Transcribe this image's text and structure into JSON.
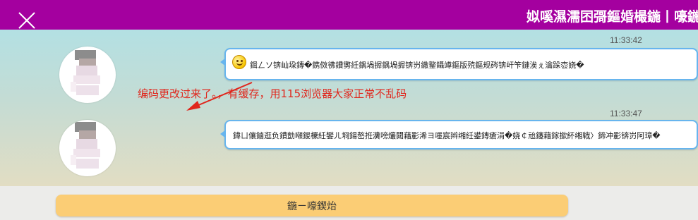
{
  "header": {
    "title": "姒嗘濕濡囨彁鏂婚樶鍦丨嚎鍦",
    "close_icon": "close-icon",
    "background": "#a4009f"
  },
  "messages": [
    {
      "timestamp": "11:33:42",
      "text": "鍓ㄥソ锛屾垜鏄�鎸傚彿鐨勶紝鍝堝搱鍝堝搱锛岃繖鐜鑷竴鏂版殑鏂规硶锛屽笇鏈涘ぇ瀹跺枩娆�",
      "emoji": "smiley-icon"
    },
    {
      "timestamp": "11:33:47",
      "text": "鍏ㄩ儴鏀逛负鐨勯噸鍐欙紝鐢ㄦ埛鍚嶅拰瀵嗙爜閮藉彲浠ヨ嚜宸辫缃紝鍙鏄瘡涓�娆￠兘鑳藉鎵撳紑缃戦〉鍗冲彲锛岃阿璋�"
    }
  ],
  "annotation": {
    "text": "编码更改过来了。，有缓存，用115浏览器大家正常不乱码",
    "color": "#e0261c"
  },
  "footer": {
    "send_button_label": "鍦ㄧ嚎鍥炲"
  },
  "colors": {
    "bubble_border": "#67b5ee",
    "send_button": "#fbcd75"
  }
}
